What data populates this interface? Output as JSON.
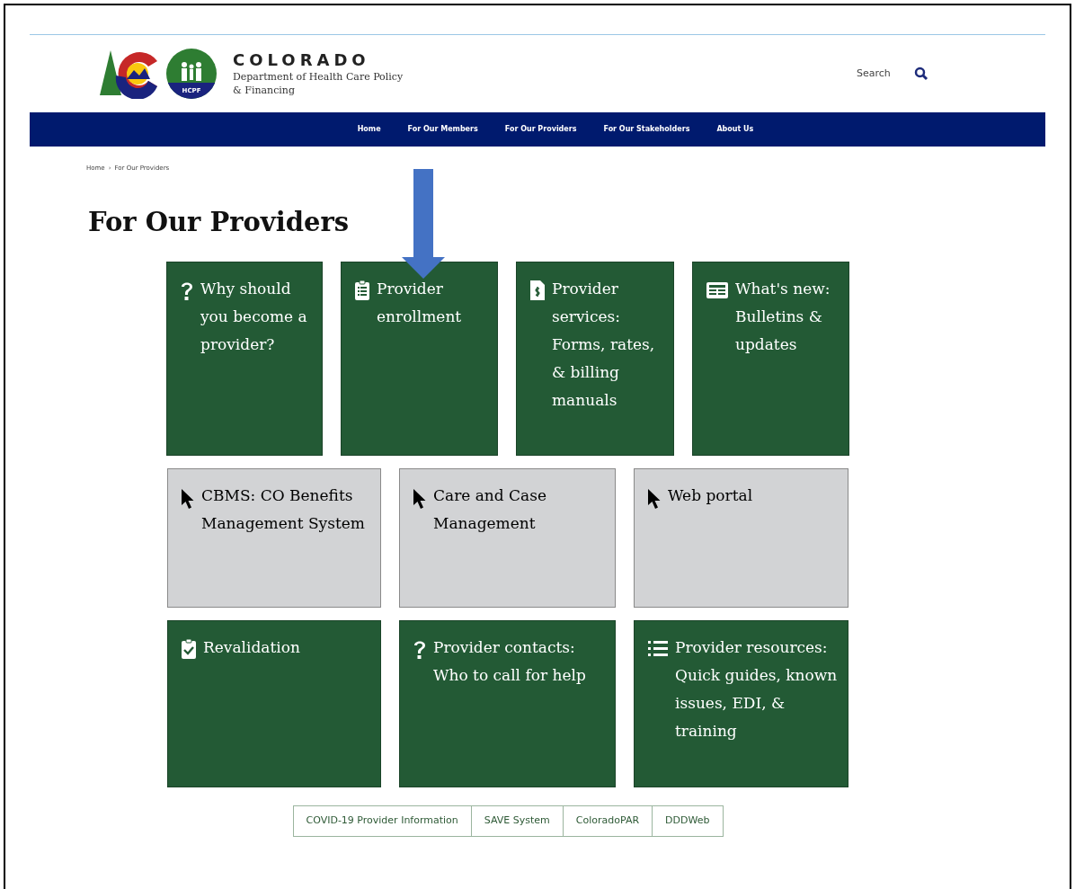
{
  "header": {
    "logo_title": "COLORADO",
    "logo_subtitle": "Department of Health Care Policy & Financing",
    "seal_text": "HCPF",
    "search": {
      "placeholder": "Search"
    }
  },
  "nav": [
    {
      "label": "Home"
    },
    {
      "label": "For Our Members"
    },
    {
      "label": "For Our Providers"
    },
    {
      "label": "For Our Stakeholders"
    },
    {
      "label": "About Us"
    }
  ],
  "breadcrumb": [
    {
      "label": "Home"
    },
    {
      "label": "For Our Providers"
    }
  ],
  "breadcrumb_separator": "›",
  "page_title": "For Our Providers",
  "tile_rows": [
    {
      "tiles": [
        {
          "kind": "section",
          "label": "Why should you become a provider?"
        },
        {
          "kind": "section",
          "label": "Provider enrollment"
        },
        {
          "kind": "section",
          "label": "Provider services: Forms, rates, & billing manuals"
        },
        {
          "kind": "section",
          "label": "What's new: Bulletins & updates"
        }
      ]
    },
    {
      "tiles": [
        {
          "kind": "portal",
          "label": "CBMS: CO Benefits Management System"
        },
        {
          "kind": "portal",
          "label": "Care and Case Management"
        },
        {
          "kind": "portal",
          "label": "Web portal"
        }
      ]
    },
    {
      "tiles": [
        {
          "kind": "section",
          "label": "Revalidation"
        },
        {
          "kind": "section",
          "label": "Provider contacts: Who to call for help"
        },
        {
          "kind": "section",
          "label": "Provider resources: Quick guides, known issues, EDI, & training"
        }
      ]
    }
  ],
  "quick_links": [
    {
      "label": "COVID-19 Provider Information"
    },
    {
      "label": "SAVE System"
    },
    {
      "label": "ColoradoPAR"
    },
    {
      "label": "DDDWeb"
    }
  ]
}
